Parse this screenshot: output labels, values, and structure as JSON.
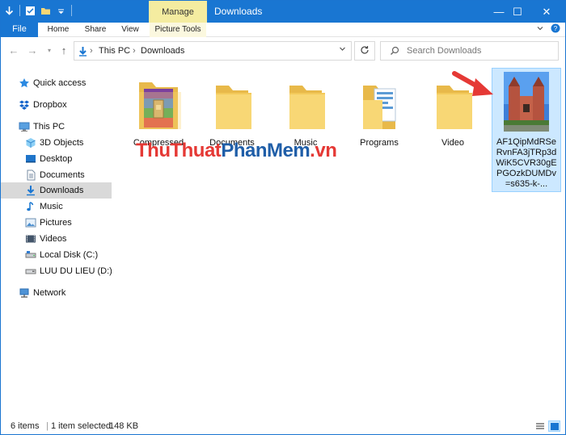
{
  "window": {
    "title": "Downloads",
    "manage_tab": "Manage",
    "controls": {
      "minimize": "—",
      "maximize": "☐",
      "close": "✕"
    }
  },
  "ribbon": {
    "tabs": [
      "File",
      "Home",
      "Share",
      "View",
      "Picture Tools"
    ]
  },
  "address": {
    "crumbs": [
      "This PC",
      "Downloads"
    ],
    "search_placeholder": "Search Downloads"
  },
  "sidebar": {
    "items": [
      {
        "label": "Quick access",
        "icon": "star-icon"
      },
      {
        "label": "Dropbox",
        "icon": "dropbox-icon"
      },
      {
        "label": "This PC",
        "icon": "computer-icon"
      },
      {
        "label": "3D Objects",
        "icon": "cube-icon"
      },
      {
        "label": "Desktop",
        "icon": "desktop-icon"
      },
      {
        "label": "Documents",
        "icon": "document-icon"
      },
      {
        "label": "Downloads",
        "icon": "download-icon",
        "selected": true
      },
      {
        "label": "Music",
        "icon": "music-icon"
      },
      {
        "label": "Pictures",
        "icon": "pictures-icon"
      },
      {
        "label": "Videos",
        "icon": "video-icon"
      },
      {
        "label": "Local Disk (C:)",
        "icon": "drive-icon"
      },
      {
        "label": "LUU DU LIEU (D:)",
        "icon": "drive-icon"
      },
      {
        "label": "Network",
        "icon": "network-icon"
      }
    ]
  },
  "files": [
    {
      "name": "Compressed",
      "type": "archive-folder"
    },
    {
      "name": "Documents",
      "type": "folder"
    },
    {
      "name": "Music",
      "type": "folder"
    },
    {
      "name": "Programs",
      "type": "folder-with-content"
    },
    {
      "name": "Video",
      "type": "folder"
    },
    {
      "name": "AF1QipMdRSeRvnFA3jTRp3dWiK5CVR30gEPGOzkDUMDv=s635-k-...",
      "type": "image",
      "selected": true
    }
  ],
  "watermark": {
    "part1": "ThuThuat",
    "part2": "PhanMem",
    "part3": ".vn"
  },
  "status": {
    "count": "6 items",
    "selection": "1 item selected",
    "size": "148 KB"
  },
  "colors": {
    "titlebar": "#1976d2",
    "manage_tab": "#f4eca0",
    "selection": "#cce8ff",
    "folder": "#f8d775",
    "arrow": "#e53935"
  }
}
